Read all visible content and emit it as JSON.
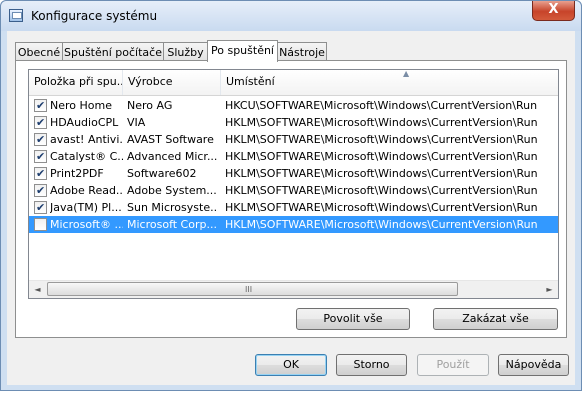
{
  "window": {
    "title": "Konfigurace systému",
    "close_glyph": "X"
  },
  "tabs": [
    {
      "label": "Obecné"
    },
    {
      "label": "Spuštění počítače"
    },
    {
      "label": "Služby"
    },
    {
      "label": "Po spuštění",
      "active": true
    },
    {
      "label": "Nástroje"
    }
  ],
  "list": {
    "columns": [
      "Položka při spu...",
      "Výrobce",
      "Umístění"
    ],
    "sort_indicator": "▲",
    "rows": [
      {
        "item": "Nero Home",
        "vendor": "Nero AG",
        "location": "HKCU\\SOFTWARE\\Microsoft\\Windows\\CurrentVersion\\Run",
        "checked": true
      },
      {
        "item": "HDAudioCPL",
        "vendor": "VIA",
        "location": "HKLM\\SOFTWARE\\Microsoft\\Windows\\CurrentVersion\\Run",
        "checked": true
      },
      {
        "item": "avast! Antivi...",
        "vendor": "AVAST Software",
        "location": "HKLM\\SOFTWARE\\Microsoft\\Windows\\CurrentVersion\\Run",
        "checked": true
      },
      {
        "item": "Catalyst® C...",
        "vendor": "Advanced Micr...",
        "location": "HKLM\\SOFTWARE\\Microsoft\\Windows\\CurrentVersion\\Run",
        "checked": true
      },
      {
        "item": "Print2PDF",
        "vendor": "Software602",
        "location": "HKLM\\SOFTWARE\\Microsoft\\Windows\\CurrentVersion\\Run",
        "checked": true
      },
      {
        "item": "Adobe Read...",
        "vendor": "Adobe System...",
        "location": "HKLM\\SOFTWARE\\Microsoft\\Windows\\CurrentVersion\\Run",
        "checked": true
      },
      {
        "item": "Java(TM) Pl...",
        "vendor": "Sun Microsyste...",
        "location": "HKLM\\SOFTWARE\\Microsoft\\Windows\\CurrentVersion\\Run",
        "checked": true
      },
      {
        "item": "Microsoft® ...",
        "vendor": "Microsoft Corp...",
        "location": "HKLM\\SOFTWARE\\Microsoft\\Windows\\CurrentVersion\\Run",
        "checked": false,
        "selected": true
      }
    ]
  },
  "scrollbar": {
    "left_arrow": "◄",
    "right_arrow": "►",
    "grip": "III"
  },
  "buttons": {
    "enable_all": "Povolit vše",
    "disable_all": "Zakázat vše",
    "ok": "OK",
    "cancel": "Storno",
    "apply": "Použít",
    "help": "Nápověda"
  },
  "colors": {
    "selection": "#3399ff",
    "close_button": "#c7442a"
  }
}
